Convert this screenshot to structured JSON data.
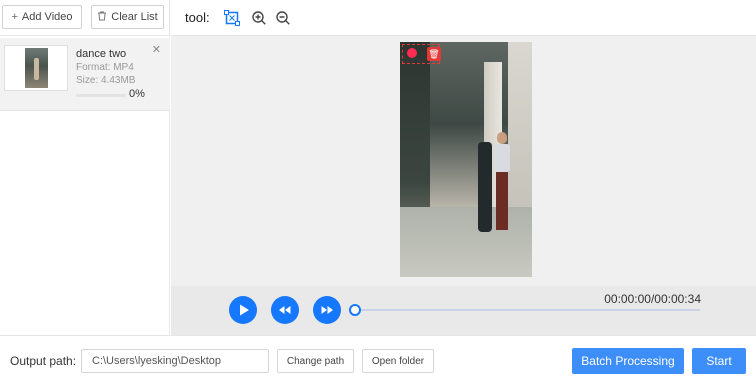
{
  "sidebar": {
    "add_video_label": "Add Video",
    "clear_list_label": "Clear List",
    "file": {
      "name": "dance two",
      "format": "Format:  MP4",
      "size": "Size:  4.43MB",
      "progress_text": "0%",
      "progress_value": 0
    }
  },
  "toolbar": {
    "tool_label": "tool:",
    "icons": [
      "select-region-icon",
      "zoom-in-icon",
      "zoom-out-icon"
    ]
  },
  "player": {
    "time": "00:00:00/00:00:34",
    "seek_position": 0
  },
  "bottom": {
    "output_path_label": "Output path:",
    "output_path_value": "C:\\Users\\lyesking\\Desktop",
    "change_path_label": "Change path",
    "open_folder_label": "Open folder",
    "batch_processing_label": "Batch Processing",
    "start_label": "Start"
  },
  "colors": {
    "accent": "#1677ff",
    "primary_button": "#3d8ef8",
    "watermark_box": "#e53935"
  }
}
